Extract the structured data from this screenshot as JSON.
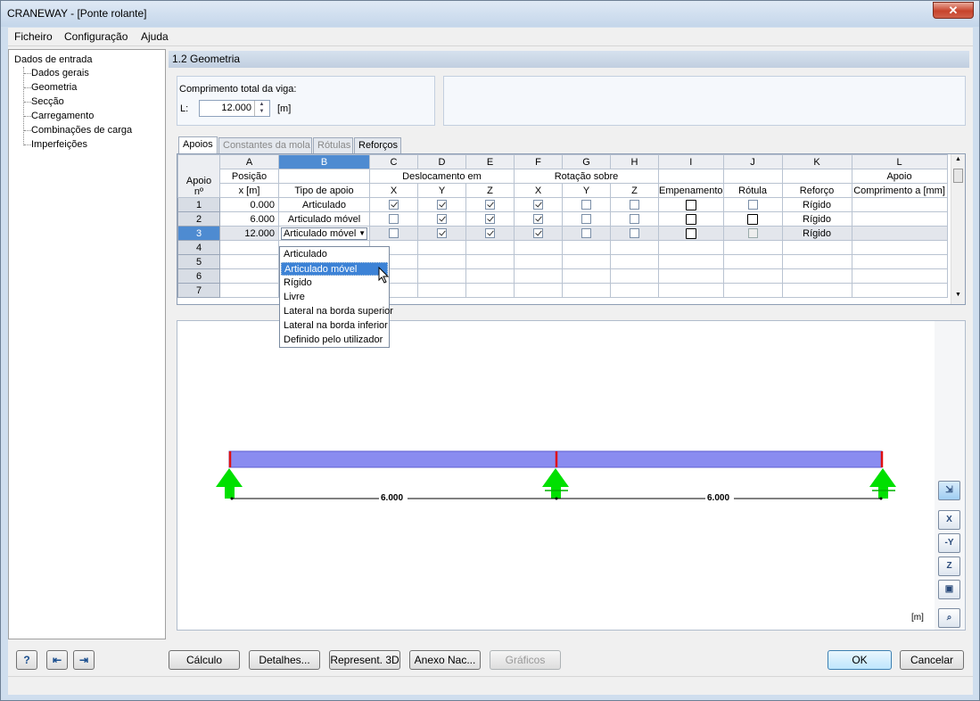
{
  "window": {
    "title": "CRANEWAY - [Ponte rolante]",
    "close_glyph": "✕"
  },
  "menu": [
    "Ficheiro",
    "Configuração",
    "Ajuda"
  ],
  "tree": {
    "root": "Dados de entrada",
    "items": [
      "Dados gerais",
      "Geometria",
      "Secção",
      "Carregamento",
      "Combinações de carga",
      "Imperfeições"
    ]
  },
  "section_title": "1.2 Geometria",
  "length": {
    "label": "Comprimento total da viga:",
    "var": "L:",
    "value": "12.000",
    "unit": "[m]"
  },
  "tabs": [
    "Apoios",
    "Constantes da mola",
    "Rótulas",
    "Reforços"
  ],
  "grid": {
    "col_letters": [
      "A",
      "B",
      "C",
      "D",
      "E",
      "F",
      "G",
      "H",
      "I",
      "J",
      "K",
      "L"
    ],
    "header_group": {
      "apoio": "Apoio\nnº",
      "posicao": "Posição",
      "desloc": "Deslocamento em",
      "rotacao": "Rotação sobre",
      "apoio_top": "Apoio"
    },
    "header_sub": [
      "x [m]",
      "Tipo de apoio",
      "X",
      "Y",
      "Z",
      "X",
      "Y",
      "Z",
      "Empenamento",
      "Rótula",
      "Reforço",
      "Comprimento a [mm]"
    ],
    "rows": [
      {
        "n": "1",
        "x": "0.000",
        "tipo": "Articulado",
        "dx": true,
        "dy": true,
        "dz": true,
        "rx": true,
        "ry": false,
        "rz": false,
        "reforco": "Rígido"
      },
      {
        "n": "2",
        "x": "6.000",
        "tipo": "Articulado móvel",
        "dx": false,
        "dy": true,
        "dz": true,
        "rx": true,
        "ry": false,
        "rz": false,
        "reforco": "Rígido"
      },
      {
        "n": "3",
        "x": "12.000",
        "tipo": "Articulado móvel",
        "dx": false,
        "dy": true,
        "dz": true,
        "rx": true,
        "ry": false,
        "rz": false,
        "reforco": "Rígido"
      }
    ],
    "empty_rows": [
      "4",
      "5",
      "6",
      "7"
    ]
  },
  "dropdown": {
    "options": [
      "Articulado",
      "Articulado móvel",
      "Rígido",
      "Livre",
      "Lateral na borda superior",
      "Lateral na borda inferior",
      "Definido pelo utilizador"
    ],
    "highlighted": 1
  },
  "view": {
    "span_labels": [
      "6.000",
      "6.000"
    ],
    "unit": "[m]",
    "tool_labels": [
      "X",
      "-Y",
      "Z"
    ]
  },
  "buttons": {
    "calculo": "Cálculo",
    "detalhes": "Detalhes...",
    "represent": "Represent. 3D",
    "anexo": "Anexo Nac...",
    "graficos": "Gráficos",
    "ok": "OK",
    "cancelar": "Cancelar"
  },
  "colors": {
    "beam": "#8a8cf0",
    "support": "#00e000",
    "accent": "#4e8bd1"
  }
}
